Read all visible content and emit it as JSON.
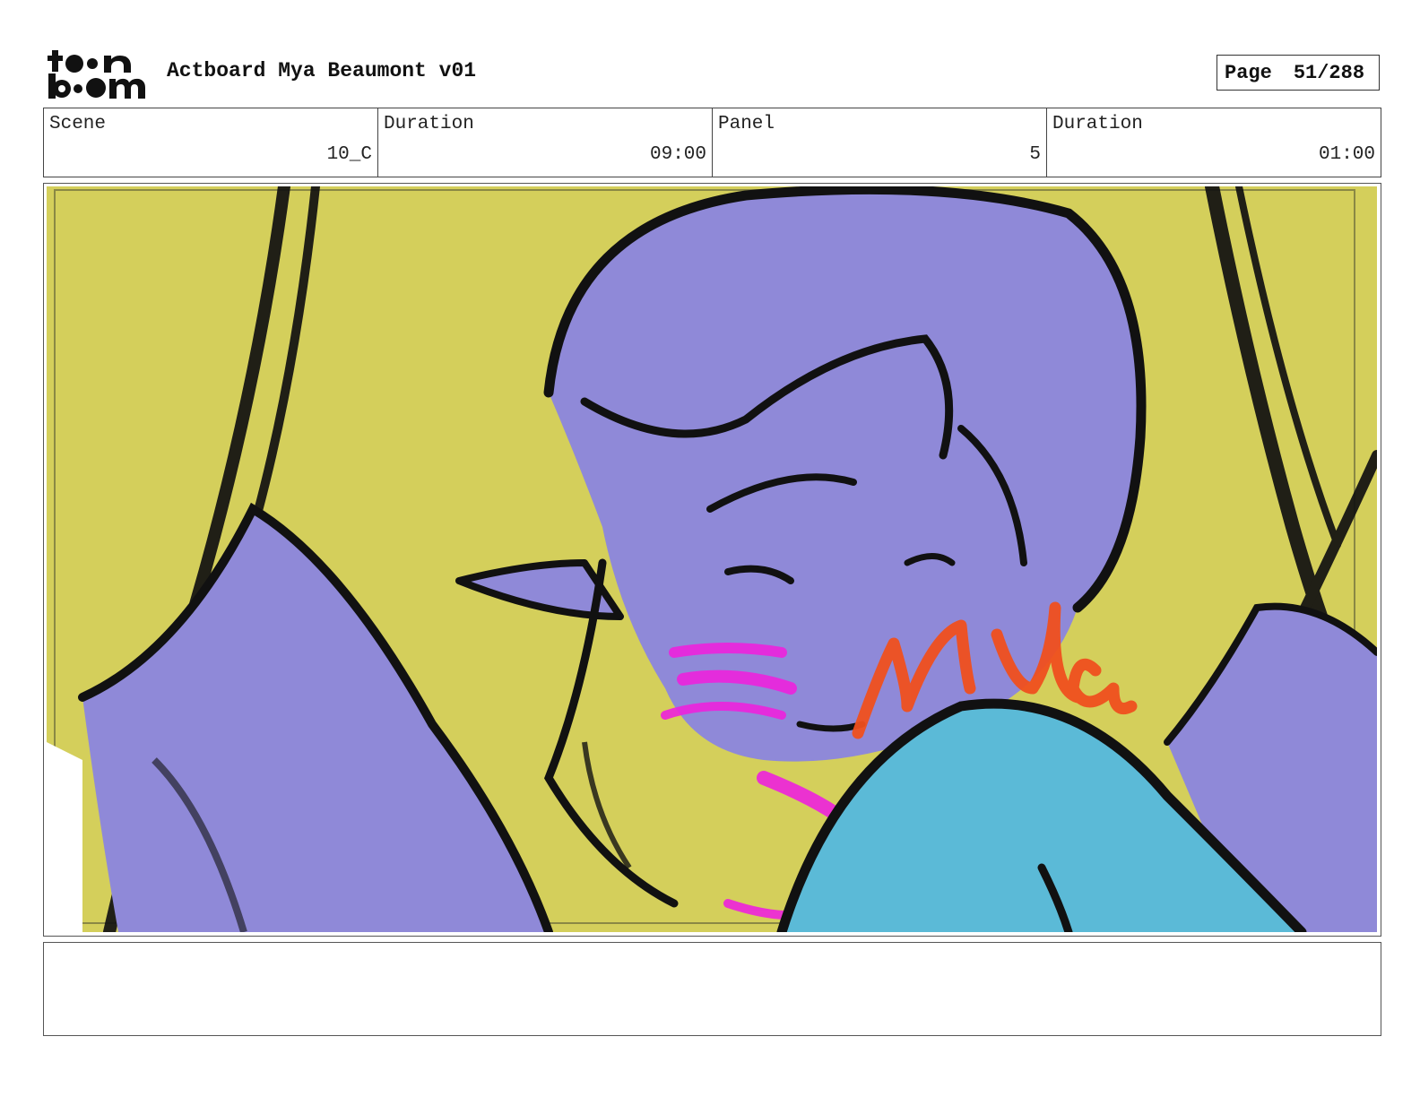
{
  "logo": {
    "line1": "toon",
    "line2": "boom"
  },
  "header": {
    "title": "Actboard Mya Beaumont v01",
    "page_label": "Page",
    "page_value": "51/288"
  },
  "info": {
    "scene_label": "Scene",
    "scene_value": "10_C",
    "scene_duration_label": "Duration",
    "scene_duration_value": "09:00",
    "panel_label": "Panel",
    "panel_value": "5",
    "panel_duration_label": "Duration",
    "panel_duration_value": "01:00"
  },
  "panel": {
    "sketch_lettering": "Mya",
    "colors": {
      "background": "#d4cf5b",
      "skin": "#8f89d8",
      "shirt": "#5bbad7",
      "blush": "#ee22dd",
      "lettering": "#f0501e",
      "line": "#111111"
    }
  },
  "notes": {
    "text": ""
  }
}
